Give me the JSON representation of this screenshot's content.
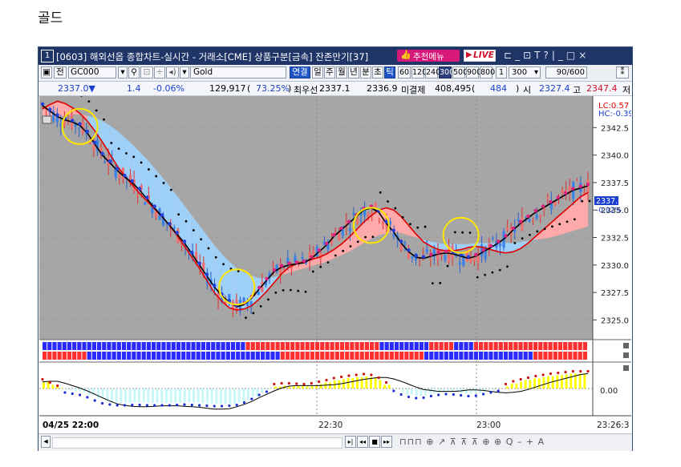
{
  "page_title": "골드",
  "window": {
    "number": "1",
    "title": "[0603] 해외선옵 종합차트-실시간 - 거래소[CME] 상품구분[금속] 잔존만기[37]",
    "recommend_menu": "추천메뉴",
    "live": "LIVE",
    "controls": [
      "ㅁ",
      "_",
      "ㅁ",
      "T",
      "?",
      "|",
      "_",
      "□",
      "×"
    ]
  },
  "toolbar": {
    "jeon": "전",
    "code": "GC000",
    "search_icon": "search-icon",
    "name": "Gold",
    "linked": "연결",
    "periods": [
      "일",
      "주",
      "월",
      "년",
      "분",
      "초",
      "틱"
    ],
    "ticks": [
      "60",
      "120",
      "240",
      "300",
      "500",
      "900",
      "800",
      "1"
    ],
    "count_value": "300",
    "display_value": "90",
    "display_total": "/600"
  },
  "infobar": {
    "price": "2337.0▼",
    "change": "1.4",
    "change_pct": "-0.06%",
    "volume": "129,917",
    "volume_pct": "73.25%",
    "best_ask_label": "최우선",
    "best_ask": "2337.1",
    "best_bid": "2336.9",
    "open_interest_label": "미결제",
    "open_interest": "408,495",
    "oi_change": "484",
    "open_label": "시",
    "open_value": "2327.4",
    "high_label": "고",
    "high_value": "2347.4",
    "low_label": "저"
  },
  "chart": {
    "lc_label": "LC:0.57",
    "hc_label": "HC:-0.39",
    "price_badge": "2337.0",
    "price_badge_sub": "-0.02%",
    "price_ticks": [
      "2342.5",
      "2340.0",
      "2337.5",
      "2335.0",
      "2332.5",
      "2330.0",
      "2327.5",
      "2325.0"
    ],
    "osc_tick": "0.00",
    "time_labels": [
      "04/25 22:00",
      "22:30",
      "23:00",
      "23:26:3"
    ]
  },
  "chart_data": {
    "type": "line",
    "title": "",
    "ylim": [
      2323.5,
      2345
    ],
    "yticks": [
      2325.0,
      2327.5,
      2330.0,
      2332.5,
      2335.0,
      2337.5,
      2340.0,
      2342.5
    ],
    "x_labels": [
      "04/25 22:00",
      "22:30",
      "23:00",
      "23:26:3"
    ],
    "series": [
      {
        "name": "",
        "values": [
          2344.2,
          2344.6,
          2344.9,
          2344.7,
          2344.3,
          2343.8,
          2343.1,
          2342.2,
          2341.2,
          2340.1,
          2339.0,
          2338.1,
          2337.3,
          2336.5,
          2335.8,
          2335.1,
          2334.4,
          2333.6,
          2332.7,
          2331.7,
          2330.7,
          2329.7,
          2328.6,
          2327.5,
          2326.7,
          2326.1,
          2325.9,
          2326.0,
          2326.3,
          2326.9,
          2327.6,
          2328.4,
          2329.2,
          2329.8,
          2330.1,
          2330.3,
          2330.5,
          2330.7,
          2331.0,
          2331.4,
          2331.9,
          2332.5,
          2333.2,
          2333.9,
          2334.5,
          2335.0,
          2335.2,
          2335.0,
          2334.4,
          2333.6,
          2332.8,
          2332.1,
          2331.7,
          2331.4,
          2331.3,
          2331.3,
          2331.4,
          2331.6,
          2331.7,
          2331.6,
          2331.4,
          2331.2,
          2331.1,
          2331.2,
          2331.5,
          2332.0,
          2332.6,
          2333.2,
          2333.8,
          2334.4,
          2335.0,
          2335.6,
          2336.2,
          2336.6
        ]
      },
      {
        "name": "",
        "values": [
          2342.8,
          2343.1,
          2343.4,
          2343.6,
          2343.7,
          2343.7,
          2343.6,
          2343.4,
          2343.1,
          2342.7,
          2342.2,
          2341.6,
          2341.0,
          2340.3,
          2339.6,
          2338.8,
          2338.0,
          2337.2,
          2336.3,
          2335.4,
          2334.5,
          2333.6,
          2332.7,
          2331.8,
          2331.0,
          2330.3,
          2329.7,
          2329.3,
          2329.0,
          2328.8,
          2328.8,
          2328.9,
          2329.1,
          2329.3,
          2329.5,
          2329.7,
          2329.9,
          2330.1,
          2330.3,
          2330.6,
          2330.9,
          2331.2,
          2331.6,
          2332.0,
          2332.4,
          2332.7,
          2332.9,
          2333.0,
          2332.9,
          2332.7,
          2332.5,
          2332.3,
          2332.1,
          2332.0,
          2331.9,
          2331.9,
          2331.9,
          2331.9,
          2332.0,
          2332.0,
          2332.0,
          2332.0,
          2332.0,
          2332.0,
          2332.1,
          2332.2,
          2332.3,
          2332.4,
          2332.5,
          2332.7,
          2332.9,
          2333.1,
          2333.3,
          2333.5
        ]
      },
      {
        "name": "",
        "values": [
          2344.5,
          2344.0,
          2343.5,
          2343.2,
          2343.0,
          2342.7,
          2342.0,
          2341.0,
          2340.0,
          2339.3,
          2338.6,
          2338.0,
          2337.5,
          2336.8,
          2336.0,
          2335.2,
          2334.4,
          2333.6,
          2332.8,
          2332.0,
          2331.0,
          2330.0,
          2329.0,
          2328.0,
          2327.2,
          2326.6,
          2326.2,
          2326.4,
          2327.0,
          2327.8,
          2328.6,
          2329.4,
          2329.8,
          2330.0,
          2330.1,
          2330.2,
          2330.6,
          2331.2,
          2331.8,
          2332.6,
          2333.2,
          2333.8,
          2334.4,
          2335.0,
          2335.2,
          2334.8,
          2333.8,
          2333.0,
          2332.0,
          2331.2,
          2330.7,
          2330.6,
          2330.8,
          2331.0,
          2331.1,
          2331.0,
          2330.8,
          2330.6,
          2330.8,
          2331.2,
          2331.6,
          2332.0,
          2332.5,
          2333.2,
          2333.8,
          2334.3,
          2334.8,
          2335.2,
          2335.6,
          2336.0,
          2336.4,
          2336.8,
          2337.0,
          2337.2
        ]
      }
    ]
  },
  "bottombar": {
    "scroll_left": "◂",
    "nav": [
      "▸|",
      "◂◂",
      "■",
      "▸▸"
    ],
    "tools_text": "⊓⊓⊓ ⊕ ↗ ⊼ ⊼ ⊼ ⊕ ⊕ Q – + A"
  },
  "colors": {
    "title_bg": "#1f3568",
    "chart_bg": "#a6a6a6",
    "red_line": "#e00000",
    "fill_up": "#ffaaaa",
    "fill_down": "#9fd0f8",
    "yellow_bar": "#ffff00",
    "cyan_bar": "#c8f8f8",
    "blue_dot": "#2040e0",
    "magenta_dot": "#e0207e"
  }
}
